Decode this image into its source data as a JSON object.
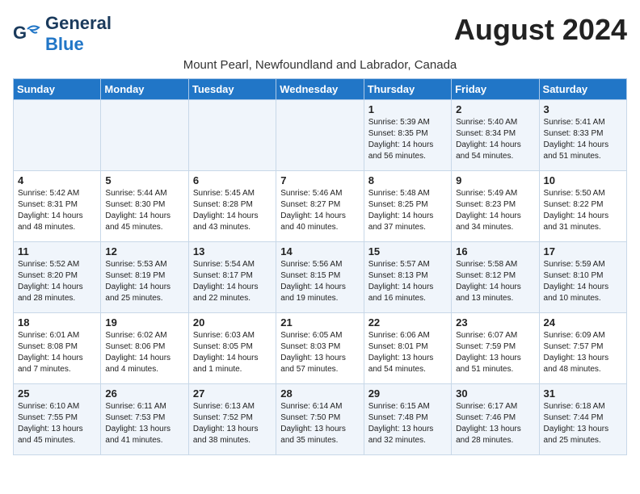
{
  "header": {
    "logo_general": "General",
    "logo_blue": "Blue",
    "month": "August 2024",
    "location": "Mount Pearl, Newfoundland and Labrador, Canada"
  },
  "weekdays": [
    "Sunday",
    "Monday",
    "Tuesday",
    "Wednesday",
    "Thursday",
    "Friday",
    "Saturday"
  ],
  "weeks": [
    [
      {
        "day": "",
        "info": ""
      },
      {
        "day": "",
        "info": ""
      },
      {
        "day": "",
        "info": ""
      },
      {
        "day": "",
        "info": ""
      },
      {
        "day": "1",
        "info": "Sunrise: 5:39 AM\nSunset: 8:35 PM\nDaylight: 14 hours and 56 minutes."
      },
      {
        "day": "2",
        "info": "Sunrise: 5:40 AM\nSunset: 8:34 PM\nDaylight: 14 hours and 54 minutes."
      },
      {
        "day": "3",
        "info": "Sunrise: 5:41 AM\nSunset: 8:33 PM\nDaylight: 14 hours and 51 minutes."
      }
    ],
    [
      {
        "day": "4",
        "info": "Sunrise: 5:42 AM\nSunset: 8:31 PM\nDaylight: 14 hours and 48 minutes."
      },
      {
        "day": "5",
        "info": "Sunrise: 5:44 AM\nSunset: 8:30 PM\nDaylight: 14 hours and 45 minutes."
      },
      {
        "day": "6",
        "info": "Sunrise: 5:45 AM\nSunset: 8:28 PM\nDaylight: 14 hours and 43 minutes."
      },
      {
        "day": "7",
        "info": "Sunrise: 5:46 AM\nSunset: 8:27 PM\nDaylight: 14 hours and 40 minutes."
      },
      {
        "day": "8",
        "info": "Sunrise: 5:48 AM\nSunset: 8:25 PM\nDaylight: 14 hours and 37 minutes."
      },
      {
        "day": "9",
        "info": "Sunrise: 5:49 AM\nSunset: 8:23 PM\nDaylight: 14 hours and 34 minutes."
      },
      {
        "day": "10",
        "info": "Sunrise: 5:50 AM\nSunset: 8:22 PM\nDaylight: 14 hours and 31 minutes."
      }
    ],
    [
      {
        "day": "11",
        "info": "Sunrise: 5:52 AM\nSunset: 8:20 PM\nDaylight: 14 hours and 28 minutes."
      },
      {
        "day": "12",
        "info": "Sunrise: 5:53 AM\nSunset: 8:19 PM\nDaylight: 14 hours and 25 minutes."
      },
      {
        "day": "13",
        "info": "Sunrise: 5:54 AM\nSunset: 8:17 PM\nDaylight: 14 hours and 22 minutes."
      },
      {
        "day": "14",
        "info": "Sunrise: 5:56 AM\nSunset: 8:15 PM\nDaylight: 14 hours and 19 minutes."
      },
      {
        "day": "15",
        "info": "Sunrise: 5:57 AM\nSunset: 8:13 PM\nDaylight: 14 hours and 16 minutes."
      },
      {
        "day": "16",
        "info": "Sunrise: 5:58 AM\nSunset: 8:12 PM\nDaylight: 14 hours and 13 minutes."
      },
      {
        "day": "17",
        "info": "Sunrise: 5:59 AM\nSunset: 8:10 PM\nDaylight: 14 hours and 10 minutes."
      }
    ],
    [
      {
        "day": "18",
        "info": "Sunrise: 6:01 AM\nSunset: 8:08 PM\nDaylight: 14 hours and 7 minutes."
      },
      {
        "day": "19",
        "info": "Sunrise: 6:02 AM\nSunset: 8:06 PM\nDaylight: 14 hours and 4 minutes."
      },
      {
        "day": "20",
        "info": "Sunrise: 6:03 AM\nSunset: 8:05 PM\nDaylight: 14 hours and 1 minute."
      },
      {
        "day": "21",
        "info": "Sunrise: 6:05 AM\nSunset: 8:03 PM\nDaylight: 13 hours and 57 minutes."
      },
      {
        "day": "22",
        "info": "Sunrise: 6:06 AM\nSunset: 8:01 PM\nDaylight: 13 hours and 54 minutes."
      },
      {
        "day": "23",
        "info": "Sunrise: 6:07 AM\nSunset: 7:59 PM\nDaylight: 13 hours and 51 minutes."
      },
      {
        "day": "24",
        "info": "Sunrise: 6:09 AM\nSunset: 7:57 PM\nDaylight: 13 hours and 48 minutes."
      }
    ],
    [
      {
        "day": "25",
        "info": "Sunrise: 6:10 AM\nSunset: 7:55 PM\nDaylight: 13 hours and 45 minutes."
      },
      {
        "day": "26",
        "info": "Sunrise: 6:11 AM\nSunset: 7:53 PM\nDaylight: 13 hours and 41 minutes."
      },
      {
        "day": "27",
        "info": "Sunrise: 6:13 AM\nSunset: 7:52 PM\nDaylight: 13 hours and 38 minutes."
      },
      {
        "day": "28",
        "info": "Sunrise: 6:14 AM\nSunset: 7:50 PM\nDaylight: 13 hours and 35 minutes."
      },
      {
        "day": "29",
        "info": "Sunrise: 6:15 AM\nSunset: 7:48 PM\nDaylight: 13 hours and 32 minutes."
      },
      {
        "day": "30",
        "info": "Sunrise: 6:17 AM\nSunset: 7:46 PM\nDaylight: 13 hours and 28 minutes."
      },
      {
        "day": "31",
        "info": "Sunrise: 6:18 AM\nSunset: 7:44 PM\nDaylight: 13 hours and 25 minutes."
      }
    ]
  ]
}
